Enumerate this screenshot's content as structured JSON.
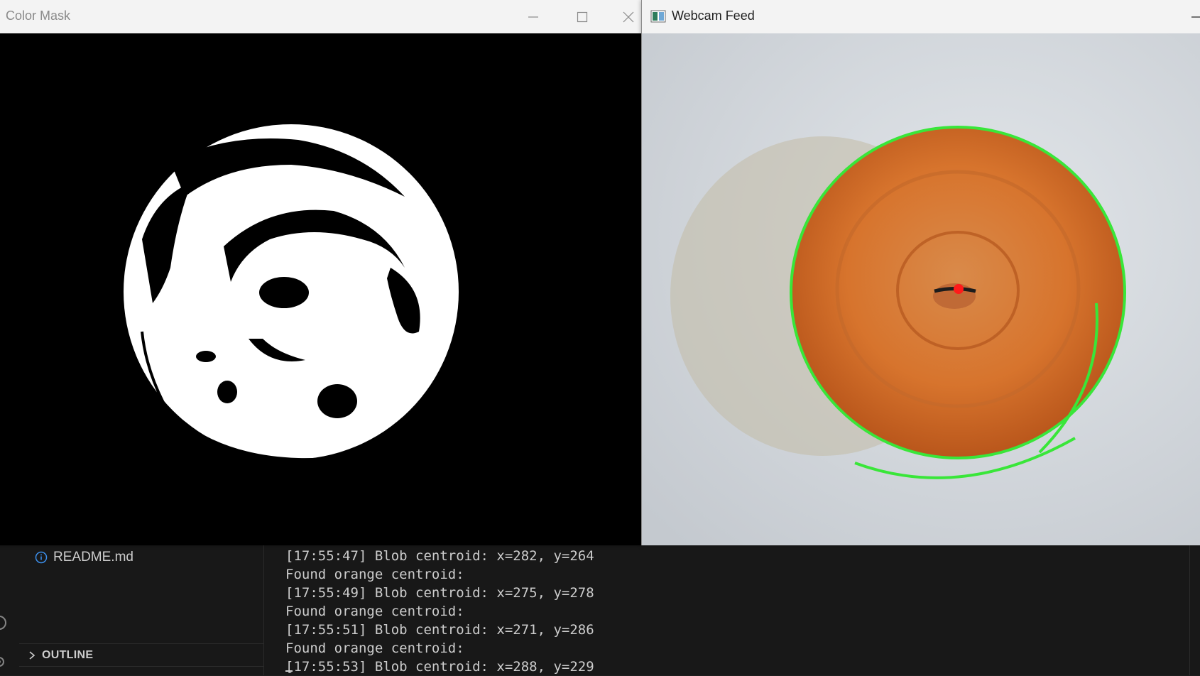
{
  "windows": {
    "color_mask": {
      "title": "Color Mask"
    },
    "webcam": {
      "title": "Webcam Feed"
    }
  },
  "explorer": {
    "file_name": "README.md",
    "outline_label": "OUTLINE"
  },
  "terminal": {
    "lines": [
      "[17:55:47] Blob centroid: x=282, y=264",
      "Found orange centroid:",
      "[17:55:49] Blob centroid: x=275, y=278",
      "Found orange centroid:",
      "[17:55:51] Blob centroid: x=271, y=286",
      "Found orange centroid:",
      "[17:55:53] Blob centroid: x=288, y=229"
    ]
  },
  "colors": {
    "contour": "#39e639",
    "centroid_dot": "#ff1a1a",
    "object_orange": "#d7742d"
  }
}
